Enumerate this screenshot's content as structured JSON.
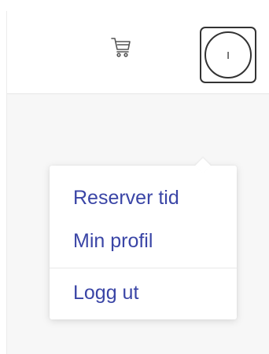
{
  "header": {
    "cart_icon": "shopping-cart-icon",
    "avatar_initial": "I",
    "avatar_icon": "user-avatar"
  },
  "user_menu": {
    "items": [
      {
        "label": "Reserver tid"
      },
      {
        "label": "Min profil"
      },
      {
        "label": "Logg ut"
      }
    ]
  },
  "colors": {
    "link": "#3a45a6",
    "background": "#f7f7f7",
    "header_bg": "#ffffff",
    "border": "#333333"
  }
}
